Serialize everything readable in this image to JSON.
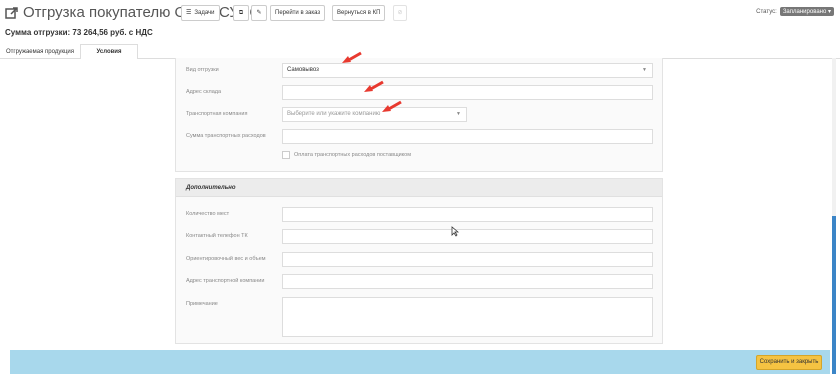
{
  "header": {
    "title": "Отгрузка покупателю ООО \"СУЭС\"",
    "buttons": {
      "tasks": "Задачи",
      "go_to_order": "Перейти в заказ",
      "back_to_kp": "Вернуться в КП"
    },
    "status_label": "Статус:",
    "status_value": "Запланировано"
  },
  "summary": "Сумма отгрузки: 73 264,56 руб. с НДС",
  "tabs": [
    {
      "label": "Отгружаемая продукция",
      "active": false
    },
    {
      "label": "Условия",
      "active": true
    }
  ],
  "section1": {
    "fields": {
      "shipment_type": {
        "label": "Вид отгрузки",
        "value": "Самовывоз"
      },
      "warehouse_address": {
        "label": "Адрес склада",
        "value": ""
      },
      "transport_company": {
        "label": "Транспортная компания",
        "placeholder": "Выберите или укажите компанию"
      },
      "transport_cost": {
        "label": "Сумма транспортных расходов",
        "value": ""
      },
      "supplier_pays": {
        "label": "Оплата транспортных расходов поставщиком",
        "checked": false
      }
    }
  },
  "section2": {
    "title": "Дополнительно",
    "fields": {
      "places_count": {
        "label": "Количество мест",
        "value": ""
      },
      "tk_phone": {
        "label": "Контактный телефон ТК",
        "value": ""
      },
      "weight_volume": {
        "label": "Ориентировочный вес и объем",
        "value": ""
      },
      "tk_address": {
        "label": "Адрес транспортной компании",
        "value": ""
      },
      "note": {
        "label": "Примечание",
        "value": ""
      }
    }
  },
  "footer": {
    "save_label": "Сохранить и закрыть"
  },
  "colors": {
    "footer_bg": "#a8d8ec",
    "save_button": "#f5c342",
    "annotation_arrow": "#e8392f",
    "scroll_thumb": "#3b85c7"
  }
}
